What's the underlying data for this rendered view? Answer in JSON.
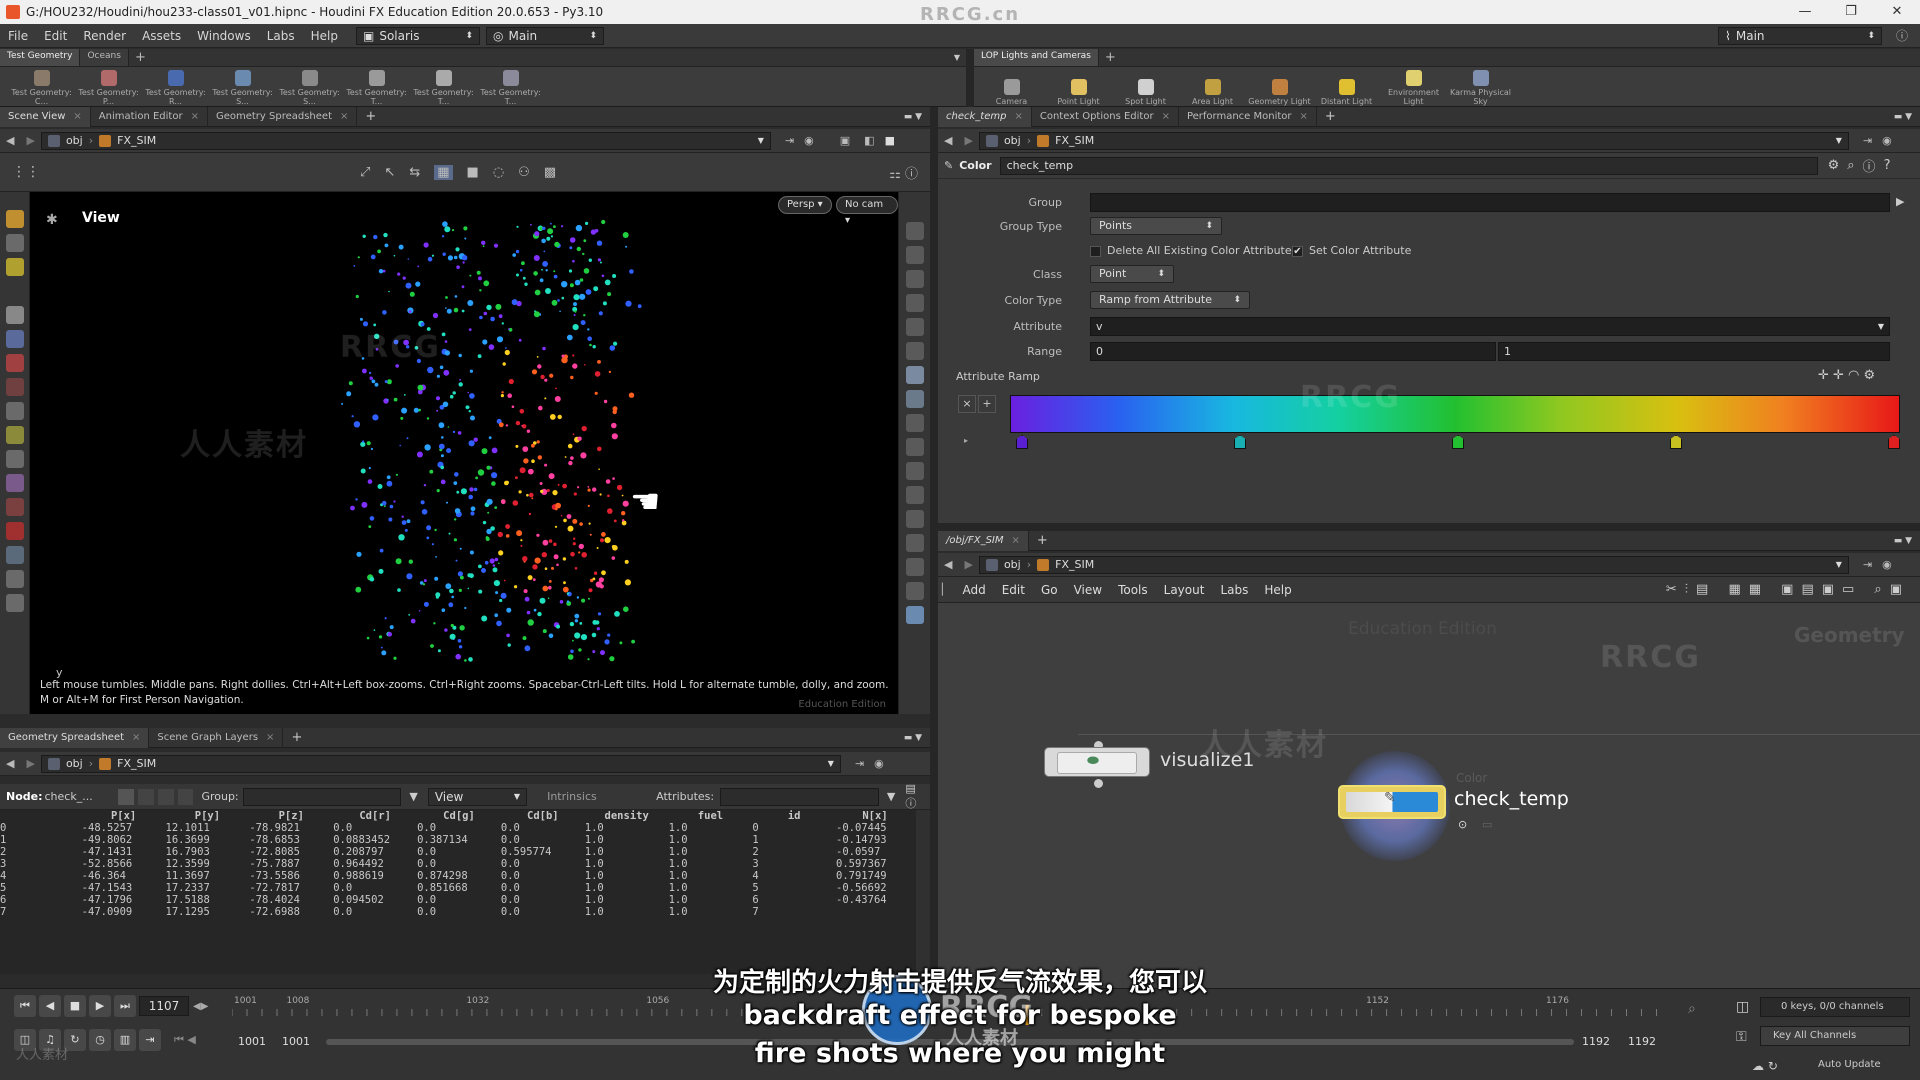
{
  "window": {
    "title": "G:/HOU232/Houdini/hou233-class01_v01.hipnc - Houdini FX Education Edition 20.0.653 - Py3.10",
    "controls": [
      "—",
      "❐",
      "✕"
    ]
  },
  "menubar": {
    "items": [
      "File",
      "Edit",
      "Render",
      "Assets",
      "Windows",
      "Labs",
      "Help"
    ],
    "desktop": "Solaris",
    "context": "Main",
    "right_desktop": "Main"
  },
  "shelf_left": {
    "tabs": [
      "Test Geometry",
      "Oceans"
    ],
    "tools": [
      {
        "label": "Test Geometry: C...",
        "color": "#8a7a6a"
      },
      {
        "label": "Test Geometry: P...",
        "color": "#b06a6a"
      },
      {
        "label": "Test Geometry: R...",
        "color": "#4a6ab0"
      },
      {
        "label": "Test Geometry: S...",
        "color": "#6a8ab0"
      },
      {
        "label": "Test Geometry: S...",
        "color": "#8a8a8a"
      },
      {
        "label": "Test Geometry: T...",
        "color": "#9a9a9a"
      },
      {
        "label": "Test Geometry: T...",
        "color": "#aaaaaa"
      },
      {
        "label": "Test Geometry: T...",
        "color": "#8a8a9a"
      }
    ]
  },
  "shelf_right": {
    "tabs": [
      "LOP Lights and Cameras"
    ],
    "tools": [
      {
        "label": "Camera",
        "color": "#9a9a9a"
      },
      {
        "label": "Point Light",
        "color": "#e0c060"
      },
      {
        "label": "Spot Light",
        "color": "#d0d0d0"
      },
      {
        "label": "Area Light",
        "color": "#c0a040"
      },
      {
        "label": "Geometry Light",
        "color": "#c08040"
      },
      {
        "label": "Distant Light",
        "color": "#e0c030"
      },
      {
        "label": "Environment Light",
        "color": "#e0d070"
      },
      {
        "label": "Karma Physical Sky",
        "color": "#8090b0"
      }
    ]
  },
  "scene_view": {
    "tabs": [
      "Scene View",
      "Animation Editor",
      "Geometry Spreadsheet"
    ],
    "path_root": "obj",
    "path_node": "FX_SIM",
    "view_label": "View",
    "persp": "Persp ▾",
    "cam": "No cam ▾",
    "axis": "y",
    "hint": "Left mouse tumbles. Middle pans. Right dollies. Ctrl+Alt+Left box-zooms. Ctrl+Right zooms. Spacebar-Ctrl-Left tilts. Hold L for alternate tumble, dolly, and zoom. M or Alt+M for First Person Navigation.",
    "edu": "Education Edition"
  },
  "spreadsheet": {
    "tabs": [
      "Geometry Spreadsheet",
      "Scene Graph Layers"
    ],
    "path_root": "obj",
    "path_node": "FX_SIM",
    "node_label": "Node:",
    "node_value": "check_...",
    "group_label": "Group:",
    "view_label": "View",
    "intrinsics": "Intrinsics",
    "attributes_label": "Attributes:",
    "columns": [
      "",
      "P[x]",
      "P[y]",
      "P[z]",
      "Cd[r]",
      "Cd[g]",
      "Cd[b]",
      "density",
      "fuel",
      "id",
      "N[x]"
    ],
    "rows": [
      [
        "0",
        "-48.5257",
        "12.1011",
        "-78.9821",
        "0.0",
        "0.0",
        "0.0",
        "1.0",
        "1.0",
        "0",
        "-0.07445"
      ],
      [
        "1",
        "-49.8062",
        "16.3699",
        "-78.6853",
        "0.0883452",
        "0.387134",
        "0.0",
        "1.0",
        "1.0",
        "1",
        "-0.14793"
      ],
      [
        "2",
        "-47.1431",
        "16.7903",
        "-72.8085",
        "0.208797",
        "0.0",
        "0.595774",
        "1.0",
        "1.0",
        "2",
        "-0.0597"
      ],
      [
        "3",
        "-52.8566",
        "12.3599",
        "-75.7887",
        "0.964492",
        "0.0",
        "0.0",
        "1.0",
        "1.0",
        "3",
        "0.597367"
      ],
      [
        "4",
        "-46.364",
        "11.3697",
        "-73.5586",
        "0.988619",
        "0.874298",
        "0.0",
        "1.0",
        "1.0",
        "4",
        "0.791749"
      ],
      [
        "5",
        "-47.1543",
        "17.2337",
        "-72.7817",
        "0.0",
        "0.851668",
        "0.0",
        "1.0",
        "1.0",
        "5",
        "-0.56692"
      ],
      [
        "6",
        "-47.1796",
        "17.5188",
        "-78.4024",
        "0.094502",
        "0.0",
        "0.0",
        "1.0",
        "1.0",
        "6",
        "-0.43764"
      ],
      [
        "7",
        "-47.0909",
        "17.1295",
        "-72.6988",
        "0.0",
        "0.0",
        "0.0",
        "1.0",
        "1.0",
        "7",
        ""
      ]
    ]
  },
  "params": {
    "tabs": [
      "check_temp",
      "Context Options Editor",
      "Performance Monitor"
    ],
    "path_root": "obj",
    "path_node": "FX_SIM",
    "node_type": "Color",
    "node_name": "check_temp",
    "group_label": "Group",
    "group_value": "",
    "group_type_label": "Group Type",
    "group_type_value": "Points",
    "delete_all_label": "Delete All Existing Color Attributes",
    "set_color_label": "Set Color Attribute",
    "class_label": "Class",
    "class_value": "Point",
    "color_type_label": "Color Type",
    "color_type_value": "Ramp from Attribute",
    "attribute_label": "Attribute",
    "attribute_value": "v",
    "range_label": "Range",
    "range_min": "0",
    "range_max": "1",
    "ramp_label": "Attribute Ramp",
    "ramp_keys": [
      {
        "pos": 0.0,
        "color": "#5a1fd0"
      },
      {
        "pos": 0.25,
        "color": "#18b0b0"
      },
      {
        "pos": 0.5,
        "color": "#22c030"
      },
      {
        "pos": 0.75,
        "color": "#c8c020"
      },
      {
        "pos": 1.0,
        "color": "#e02020"
      }
    ]
  },
  "network": {
    "tabs": [
      "/obj/FX_SIM"
    ],
    "path_root": "obj",
    "path_node": "FX_SIM",
    "menu": [
      "Add",
      "Edit",
      "Go",
      "View",
      "Tools",
      "Layout",
      "Labs",
      "Help"
    ],
    "edu": "Education Edition",
    "context": "Geometry",
    "nodes": [
      {
        "name": "visualize1",
        "type": ""
      },
      {
        "name": "check_temp",
        "type": "Color"
      }
    ]
  },
  "timeline": {
    "frame": "1107",
    "ticks": [
      "1001",
      "1008",
      "1032",
      "1056",
      "1152",
      "1176"
    ],
    "start": "1001",
    "start2": "1001",
    "end": "1192",
    "end2": "1192",
    "keys": "0 keys, 0/0 channels",
    "key_all": "Key All Channels",
    "auto_update": "Auto Update"
  },
  "subtitles": {
    "line1": "为定制的火力射击提供反气流效果，您可以",
    "line2": "backdraft effect for bespoke",
    "line3": "fire shots where you might"
  },
  "watermark": {
    "rrcg": "RRCG",
    "cn": "人人素材",
    "url": "RRCG.cn"
  }
}
